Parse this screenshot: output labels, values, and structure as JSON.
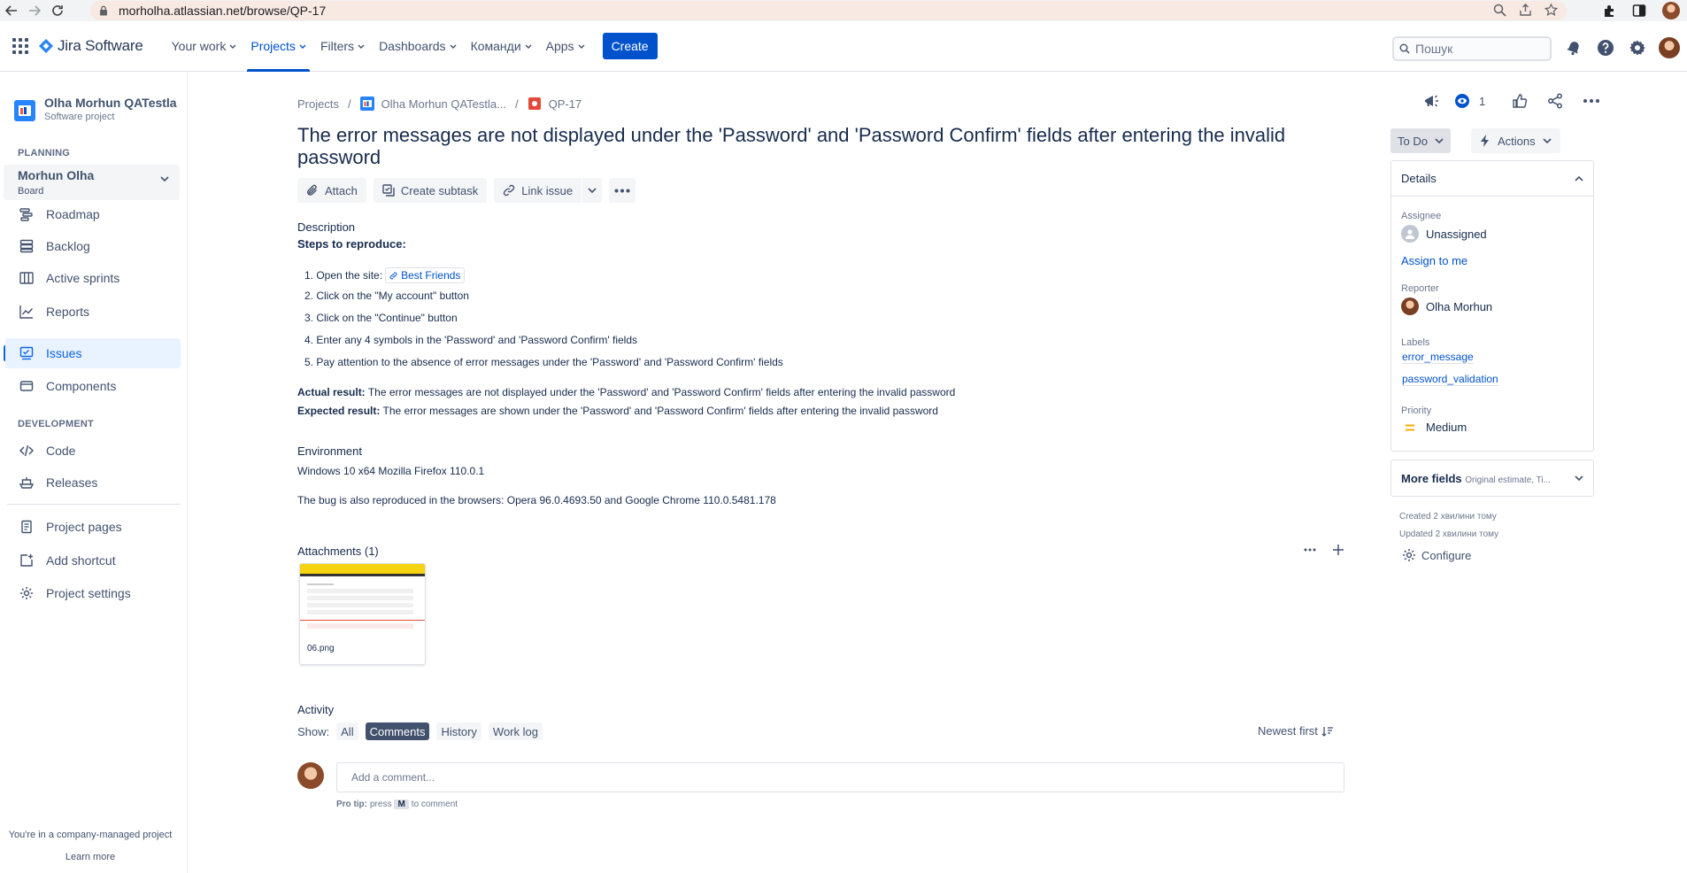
{
  "browser": {
    "url": "morholha.atlassian.net/browse/QP-17"
  },
  "topnav": {
    "product": "Jira Software",
    "items": [
      "Your work",
      "Projects",
      "Filters",
      "Dashboards",
      "Команди",
      "Apps"
    ],
    "create_label": "Create",
    "search_placeholder": "Пошук"
  },
  "sidebar": {
    "project_name": "Olha Morhun QATestla...",
    "project_type": "Software project",
    "planning_label": "PLANNING",
    "board_name": "Morhun Olha",
    "board_sub": "Board",
    "planning_items": [
      "Roadmap",
      "Backlog",
      "Active sprints",
      "Reports",
      "Issues",
      "Components"
    ],
    "development_label": "DEVELOPMENT",
    "development_items": [
      "Code",
      "Releases"
    ],
    "other_items": [
      "Project pages",
      "Add shortcut",
      "Project settings"
    ],
    "footer_text": "You're in a company-managed project",
    "footer_link": "Learn more"
  },
  "issue": {
    "breadcrumb": [
      "Projects",
      "Olha Morhun QATestla...",
      "QP-17"
    ],
    "watch_count": "1",
    "title": "The error messages are not displayed under the 'Password' and 'Password Confirm' fields after entering the invalid password",
    "action_buttons": [
      "Attach",
      "Create subtask",
      "Link issue"
    ],
    "description_label": "Description",
    "steps_title": "Steps to reproduce:",
    "steps": [
      "1. Open the site:",
      "2. Click on the \"My account\" button",
      "3. Click on the \"Continue\" button",
      "4. Enter any 4 symbols in the 'Password' and 'Password Confirm' fields",
      "5. Pay attention to the absence of error messages under the 'Password' and 'Password Confirm' fields"
    ],
    "site_link": "Best Friends",
    "actual_label": "Actual result:",
    "actual_text": "The error messages are not displayed under the 'Password' and 'Password Confirm' fields after entering the invalid password",
    "expected_label": "Expected result:",
    "expected_text": "The error messages are shown under the 'Password' and 'Password Confirm' fields after entering the invalid password",
    "environment_label": "Environment",
    "environment_text": "Windows 10 x64 Mozilla Firefox 110.0.1",
    "environment_note": "The bug is also reproduced in the browsers: Opera 96.0.4693.50 and Google Chrome 110.0.5481.178",
    "attachments_label": "Attachments (1)",
    "attachment_name": "06.png",
    "activity_label": "Activity",
    "show_label": "Show:",
    "filters": [
      "All",
      "Comments",
      "History",
      "Work log"
    ],
    "active_filter": "Comments",
    "sort_label": "Newest first",
    "comment_placeholder": "Add a comment...",
    "protip_prefix": "Pro tip:",
    "protip_press": "press",
    "protip_key": "M",
    "protip_suffix": "to comment"
  },
  "details": {
    "status": "To Do",
    "actions_label": "Actions",
    "header": "Details",
    "assignee_label": "Assignee",
    "assignee": "Unassigned",
    "assign_to_me": "Assign to me",
    "reporter_label": "Reporter",
    "reporter": "Olha Morhun",
    "labels_label": "Labels",
    "labels": [
      "error_message",
      "password_validation"
    ],
    "priority_label": "Priority",
    "priority": "Medium",
    "more_fields": "More fields",
    "more_fields_hint": "Original estimate, Ti...",
    "created": "Created 2 хвилини тому",
    "updated": "Updated 2 хвилини тому",
    "configure": "Configure"
  },
  "colors": {
    "brand_blue": "#0052CC",
    "text_dark": "#172B4D",
    "text_subtle": "#42526E",
    "selected_bg": "#E9F2FF",
    "priority_medium": "#FFAB00"
  }
}
